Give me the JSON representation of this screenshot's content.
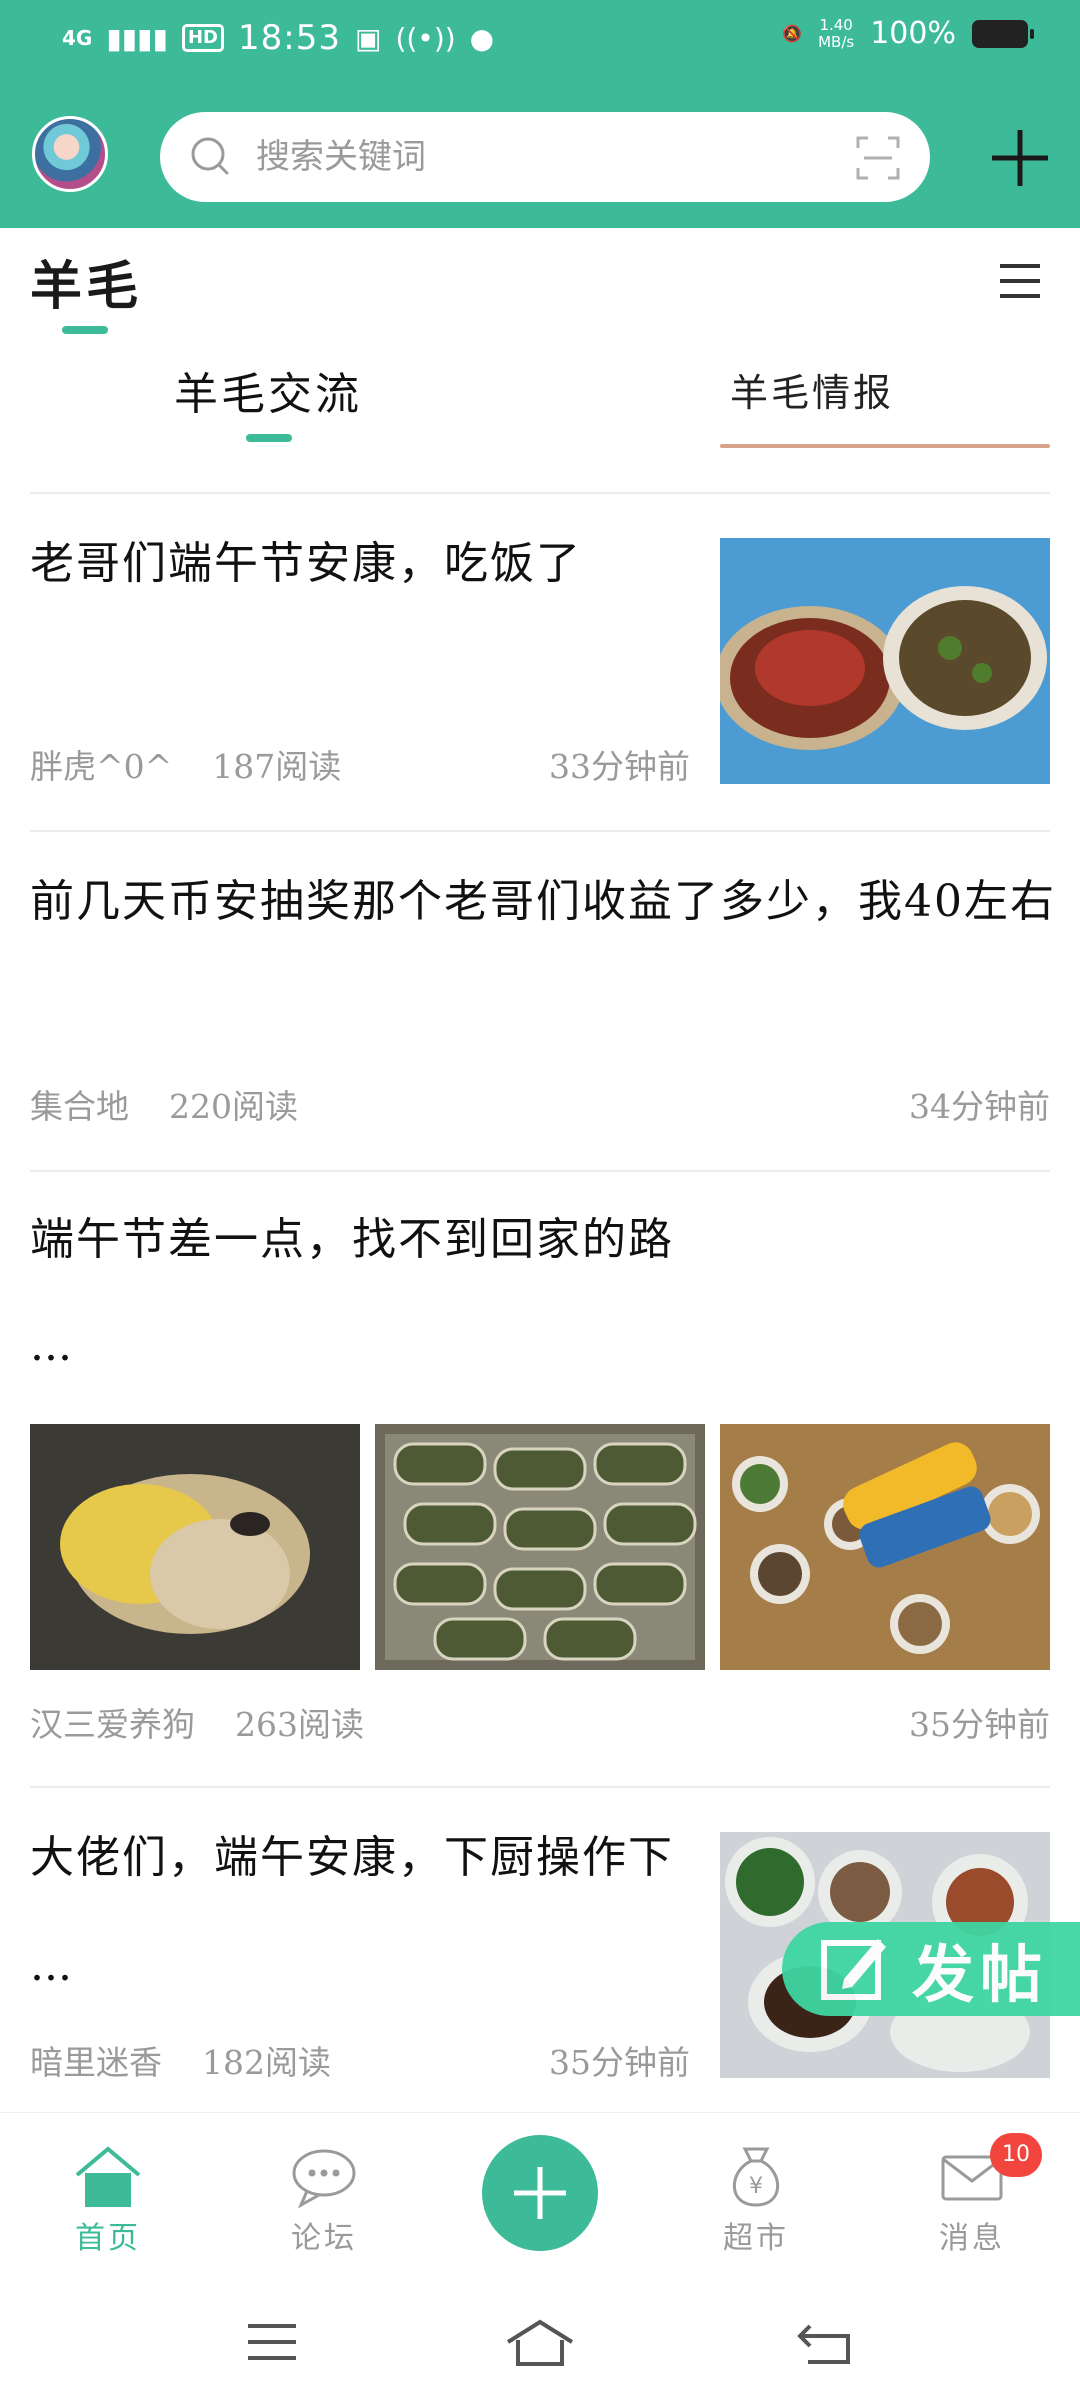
{
  "status_bar": {
    "network": "4G",
    "hd": "HD",
    "time": "18:53",
    "speed": "1.40\nMB/s",
    "battery": "100%"
  },
  "header": {
    "search_placeholder": "搜索关键词"
  },
  "section": {
    "title": "羊毛"
  },
  "tabs": [
    {
      "label": "羊毛交流"
    },
    {
      "label": "羊毛情报"
    }
  ],
  "posts": [
    {
      "title": "老哥们端午节安康，吃饭了",
      "author": "胖虎^0^",
      "reads": "187阅读",
      "time": "33分钟前"
    },
    {
      "title": "前几天币安抽奖那个老哥们收益了多少，我40左右",
      "author": "集合地",
      "reads": "220阅读",
      "time": "34分钟前"
    },
    {
      "title": "端午节差一点，找不到回家的路",
      "ellipsis": "...",
      "author": "汉三爱养狗",
      "reads": "263阅读",
      "time": "35分钟前"
    },
    {
      "title": "大佬们，端午安康，下厨操作下",
      "ellipsis": "...",
      "author": "暗里迷香",
      "reads": "182阅读",
      "time": "35分钟前"
    }
  ],
  "fab": {
    "label": "发帖"
  },
  "bottom_nav": [
    {
      "label": "首页",
      "icon": "home-icon",
      "active": true
    },
    {
      "label": "论坛",
      "icon": "chat-icon"
    },
    {
      "label": "",
      "icon": "plus-icon"
    },
    {
      "label": "超市",
      "icon": "money-bag-icon"
    },
    {
      "label": "消息",
      "icon": "mail-icon",
      "badge": "10"
    }
  ],
  "colors": {
    "accent": "#3dbb99",
    "badge": "#f2453d",
    "fab": "#3fd6a3"
  }
}
